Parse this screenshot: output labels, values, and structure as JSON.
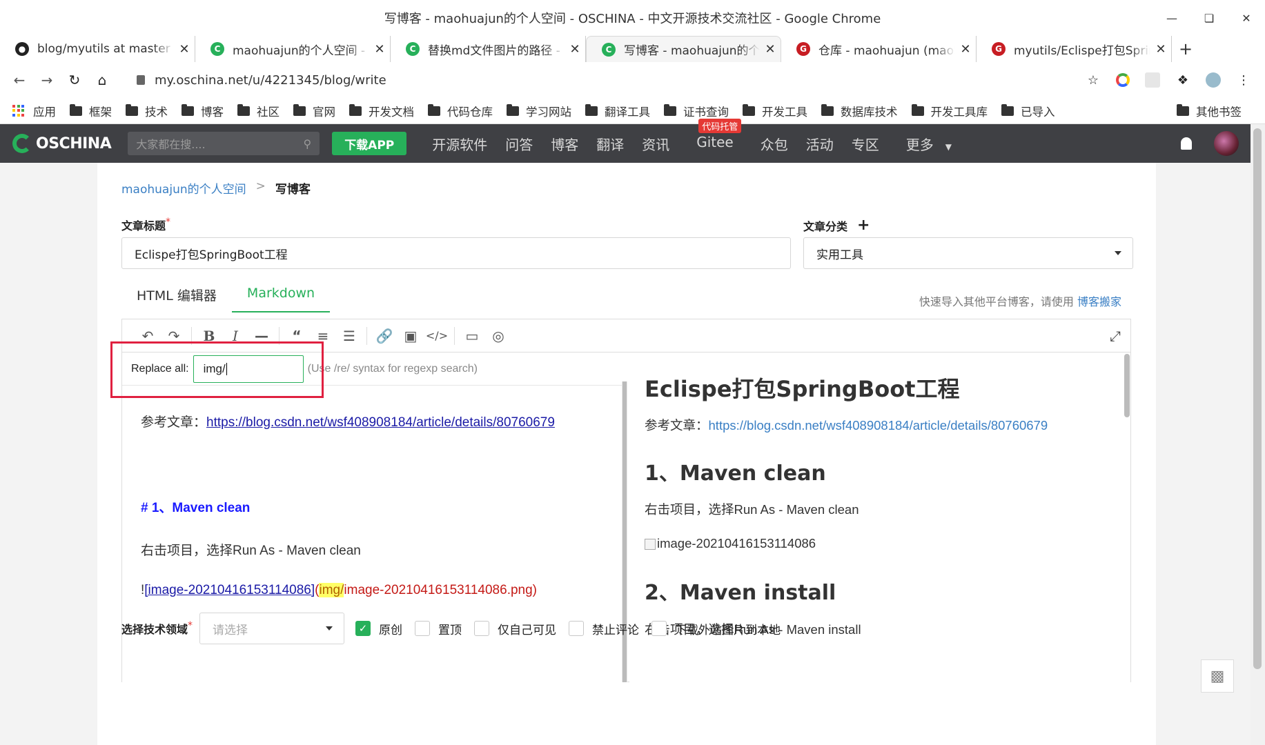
{
  "window": {
    "title": "写博客 - maohuajun的个人空间 - OSCHINA - 中文开源技术交流社区 - Google Chrome"
  },
  "tabs": [
    {
      "label": "blog/myutils at master · ",
      "icon": "github-icon",
      "color": "#222222"
    },
    {
      "label": "maohuajun的个人空间 - O",
      "icon": "oschina-icon",
      "color": "#27b05a"
    },
    {
      "label": "替换md文件图片的路径 - m",
      "icon": "oschina-icon",
      "color": "#27b05a"
    },
    {
      "label": "写博客 - maohuajun的个人",
      "icon": "oschina-icon",
      "color": "#27b05a"
    },
    {
      "label": "仓库 - maohuajun (maoh",
      "icon": "gitee-icon",
      "color": "#c71d23"
    },
    {
      "label": "myutils/Eclispe打包Sprin",
      "icon": "gitee-icon",
      "color": "#c71d23"
    }
  ],
  "address": {
    "url": "my.oschina.net/u/4221345/blog/write"
  },
  "bookmarks": {
    "apps_label": "应用",
    "items": [
      "框架",
      "技术",
      "博客",
      "社区",
      "官网",
      "开发文档",
      "代码仓库",
      "学习网站",
      "翻译工具",
      "证书查询",
      "开发工具",
      "数据库技术",
      "开发工具库",
      "已导入"
    ],
    "other": "其他书签"
  },
  "oschina": {
    "logo": "OSCHINA",
    "search_placeholder": "大家都在搜....",
    "download": "下载APP",
    "nav": [
      "开源软件",
      "问答",
      "博客",
      "翻译",
      "资讯",
      "Gitee",
      "众包",
      "活动",
      "专区",
      "更多"
    ],
    "gitee_badge": "代码托管"
  },
  "breadcrumb": {
    "home": "maohuajun的个人空间",
    "sep": ">",
    "current": "写博客"
  },
  "form": {
    "title_label": "文章标题",
    "title_value": "Eclispe打包SpringBoot工程",
    "category_label": "文章分类",
    "category_value": "实用工具",
    "tech_label": "选择技术领域",
    "tech_placeholder": "请选择"
  },
  "editor_tabs": {
    "html": "HTML 编辑器",
    "markdown": "Markdown"
  },
  "migrate": {
    "text": "快速导入其他平台博客，请使用 ",
    "link": "博客搬家"
  },
  "replace": {
    "label": "Replace all:",
    "value": "img/",
    "hint": "(Use /re/ syntax for regexp search)"
  },
  "source": {
    "ref_prefix": "参考文章：",
    "ref_link": "https://blog.csdn.net/wsf408908184/article/details/80760679",
    "h1": "# 1、Maven clean",
    "p1": "右击项目，选择Run As - Maven clean",
    "img_bang": "!",
    "img_alt": "[image-20210416153114086]",
    "img_paren_open": "(",
    "img_match": "img/",
    "img_rest": "image-20210416153114086.png)"
  },
  "preview": {
    "title": "Eclispe打包SpringBoot工程",
    "ref_prefix": "参考文章：",
    "ref_link": "https://blog.csdn.net/wsf408908184/article/details/80760679",
    "h1": "1、Maven clean",
    "p1": "右击项目，选择Run As - Maven clean",
    "img_alt": "image-20210416153114086",
    "h2": "2、Maven install",
    "p2": "右击项目，选择Run As - Maven install"
  },
  "options": {
    "original": "原创",
    "top": "置顶",
    "private": "仅自己可见",
    "no_comment": "禁止评论",
    "download_images": "下载外站图片到本地"
  }
}
